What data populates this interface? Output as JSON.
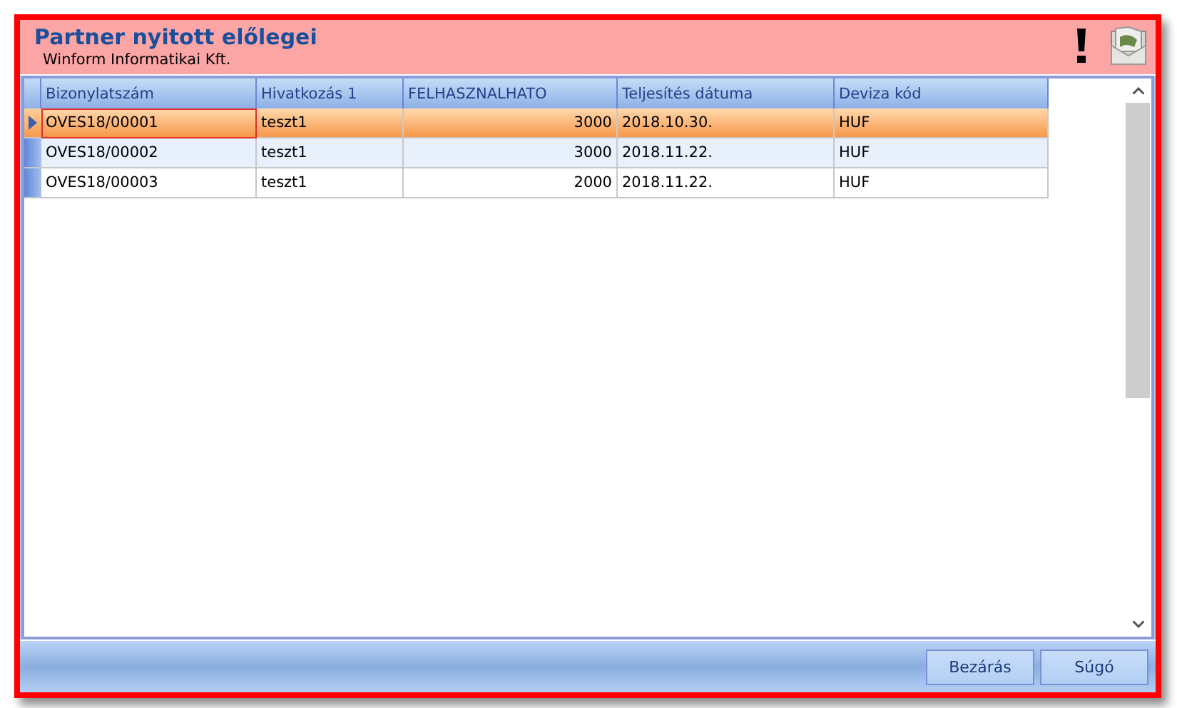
{
  "window": {
    "title": "Partner nyitott előlegei",
    "subtitle": "Winform Informatikai Kft."
  },
  "table": {
    "columns": [
      {
        "label": "Bizonylatszám",
        "kind": "text"
      },
      {
        "label": "Hivatkozás 1",
        "kind": "text"
      },
      {
        "label": "FELHASZNALHATO",
        "kind": "number"
      },
      {
        "label": "Teljesítés dátuma",
        "kind": "date"
      },
      {
        "label": "Deviza kód",
        "kind": "text"
      }
    ],
    "rows": [
      {
        "selected": true,
        "cells": [
          "OVES18/00001",
          "teszt1",
          "3000",
          "2018.10.30.",
          "HUF"
        ]
      },
      {
        "selected": false,
        "cells": [
          "OVES18/00002",
          "teszt1",
          "3000",
          "2018.11.22.",
          "HUF"
        ]
      },
      {
        "selected": false,
        "cells": [
          "OVES18/00003",
          "teszt1",
          "2000",
          "2018.11.22.",
          "HUF"
        ]
      }
    ]
  },
  "buttons": [
    {
      "label": "Bezárás"
    },
    {
      "label": "Súgó"
    }
  ]
}
